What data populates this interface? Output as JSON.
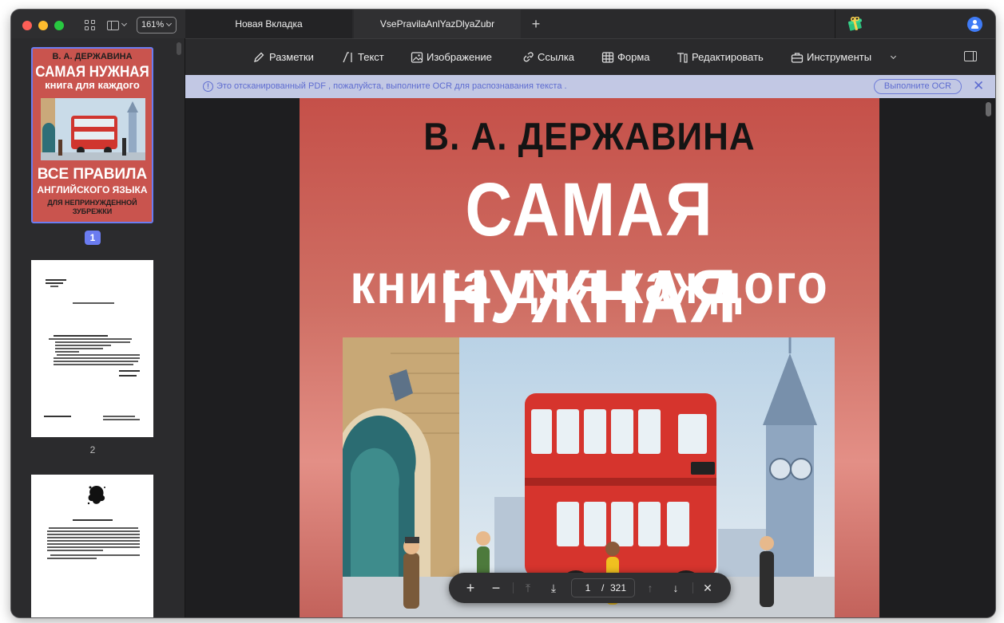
{
  "toolbar_top": {
    "zoom": "161%"
  },
  "tabs": [
    {
      "label": "Новая Вкладка"
    },
    {
      "label": "VsePravilaAnlYazDlyaZubr"
    }
  ],
  "tab_add": "+",
  "tools": [
    {
      "label": "Разметки",
      "icon": "pencil-icon"
    },
    {
      "label": "Текст",
      "icon": "text-icon"
    },
    {
      "label": "Изображение",
      "icon": "image-icon"
    },
    {
      "label": "Ссылка",
      "icon": "link-icon"
    },
    {
      "label": "Форма",
      "icon": "form-icon"
    },
    {
      "label": "Редактировать",
      "icon": "edit-icon"
    },
    {
      "label": "Инструменты",
      "icon": "toolbox-icon"
    }
  ],
  "ocr_banner": {
    "message": "Это отсканированный PDF , пожалуйста, выполните OCR для распознавания текста .",
    "button": "Выполните OCR"
  },
  "cover": {
    "author": "В. А. ДЕРЖАВИНА",
    "title_line1": "САМАЯ НУЖНАЯ",
    "title_line2": "книга для каждого",
    "rules_line1": "ВСЕ ПРАВИЛА",
    "rules_line2": "АНГЛИЙСКОГО ЯЗЫКА",
    "rules_line3": "ДЛЯ НЕПРИНУЖДЕННОЙ",
    "rules_line4": "ЗУБРЕЖКИ"
  },
  "thumbnails": [
    {
      "label": "1",
      "selected": true
    },
    {
      "label": "2",
      "selected": false
    }
  ],
  "page_nav": {
    "current": "1",
    "separator": "/",
    "total": "321"
  },
  "colors": {
    "accent": "#6b7cf0",
    "cover_red": "#c55049",
    "ocr_banner": "#c2c8e4",
    "ocr_text": "#5e6cd0"
  }
}
